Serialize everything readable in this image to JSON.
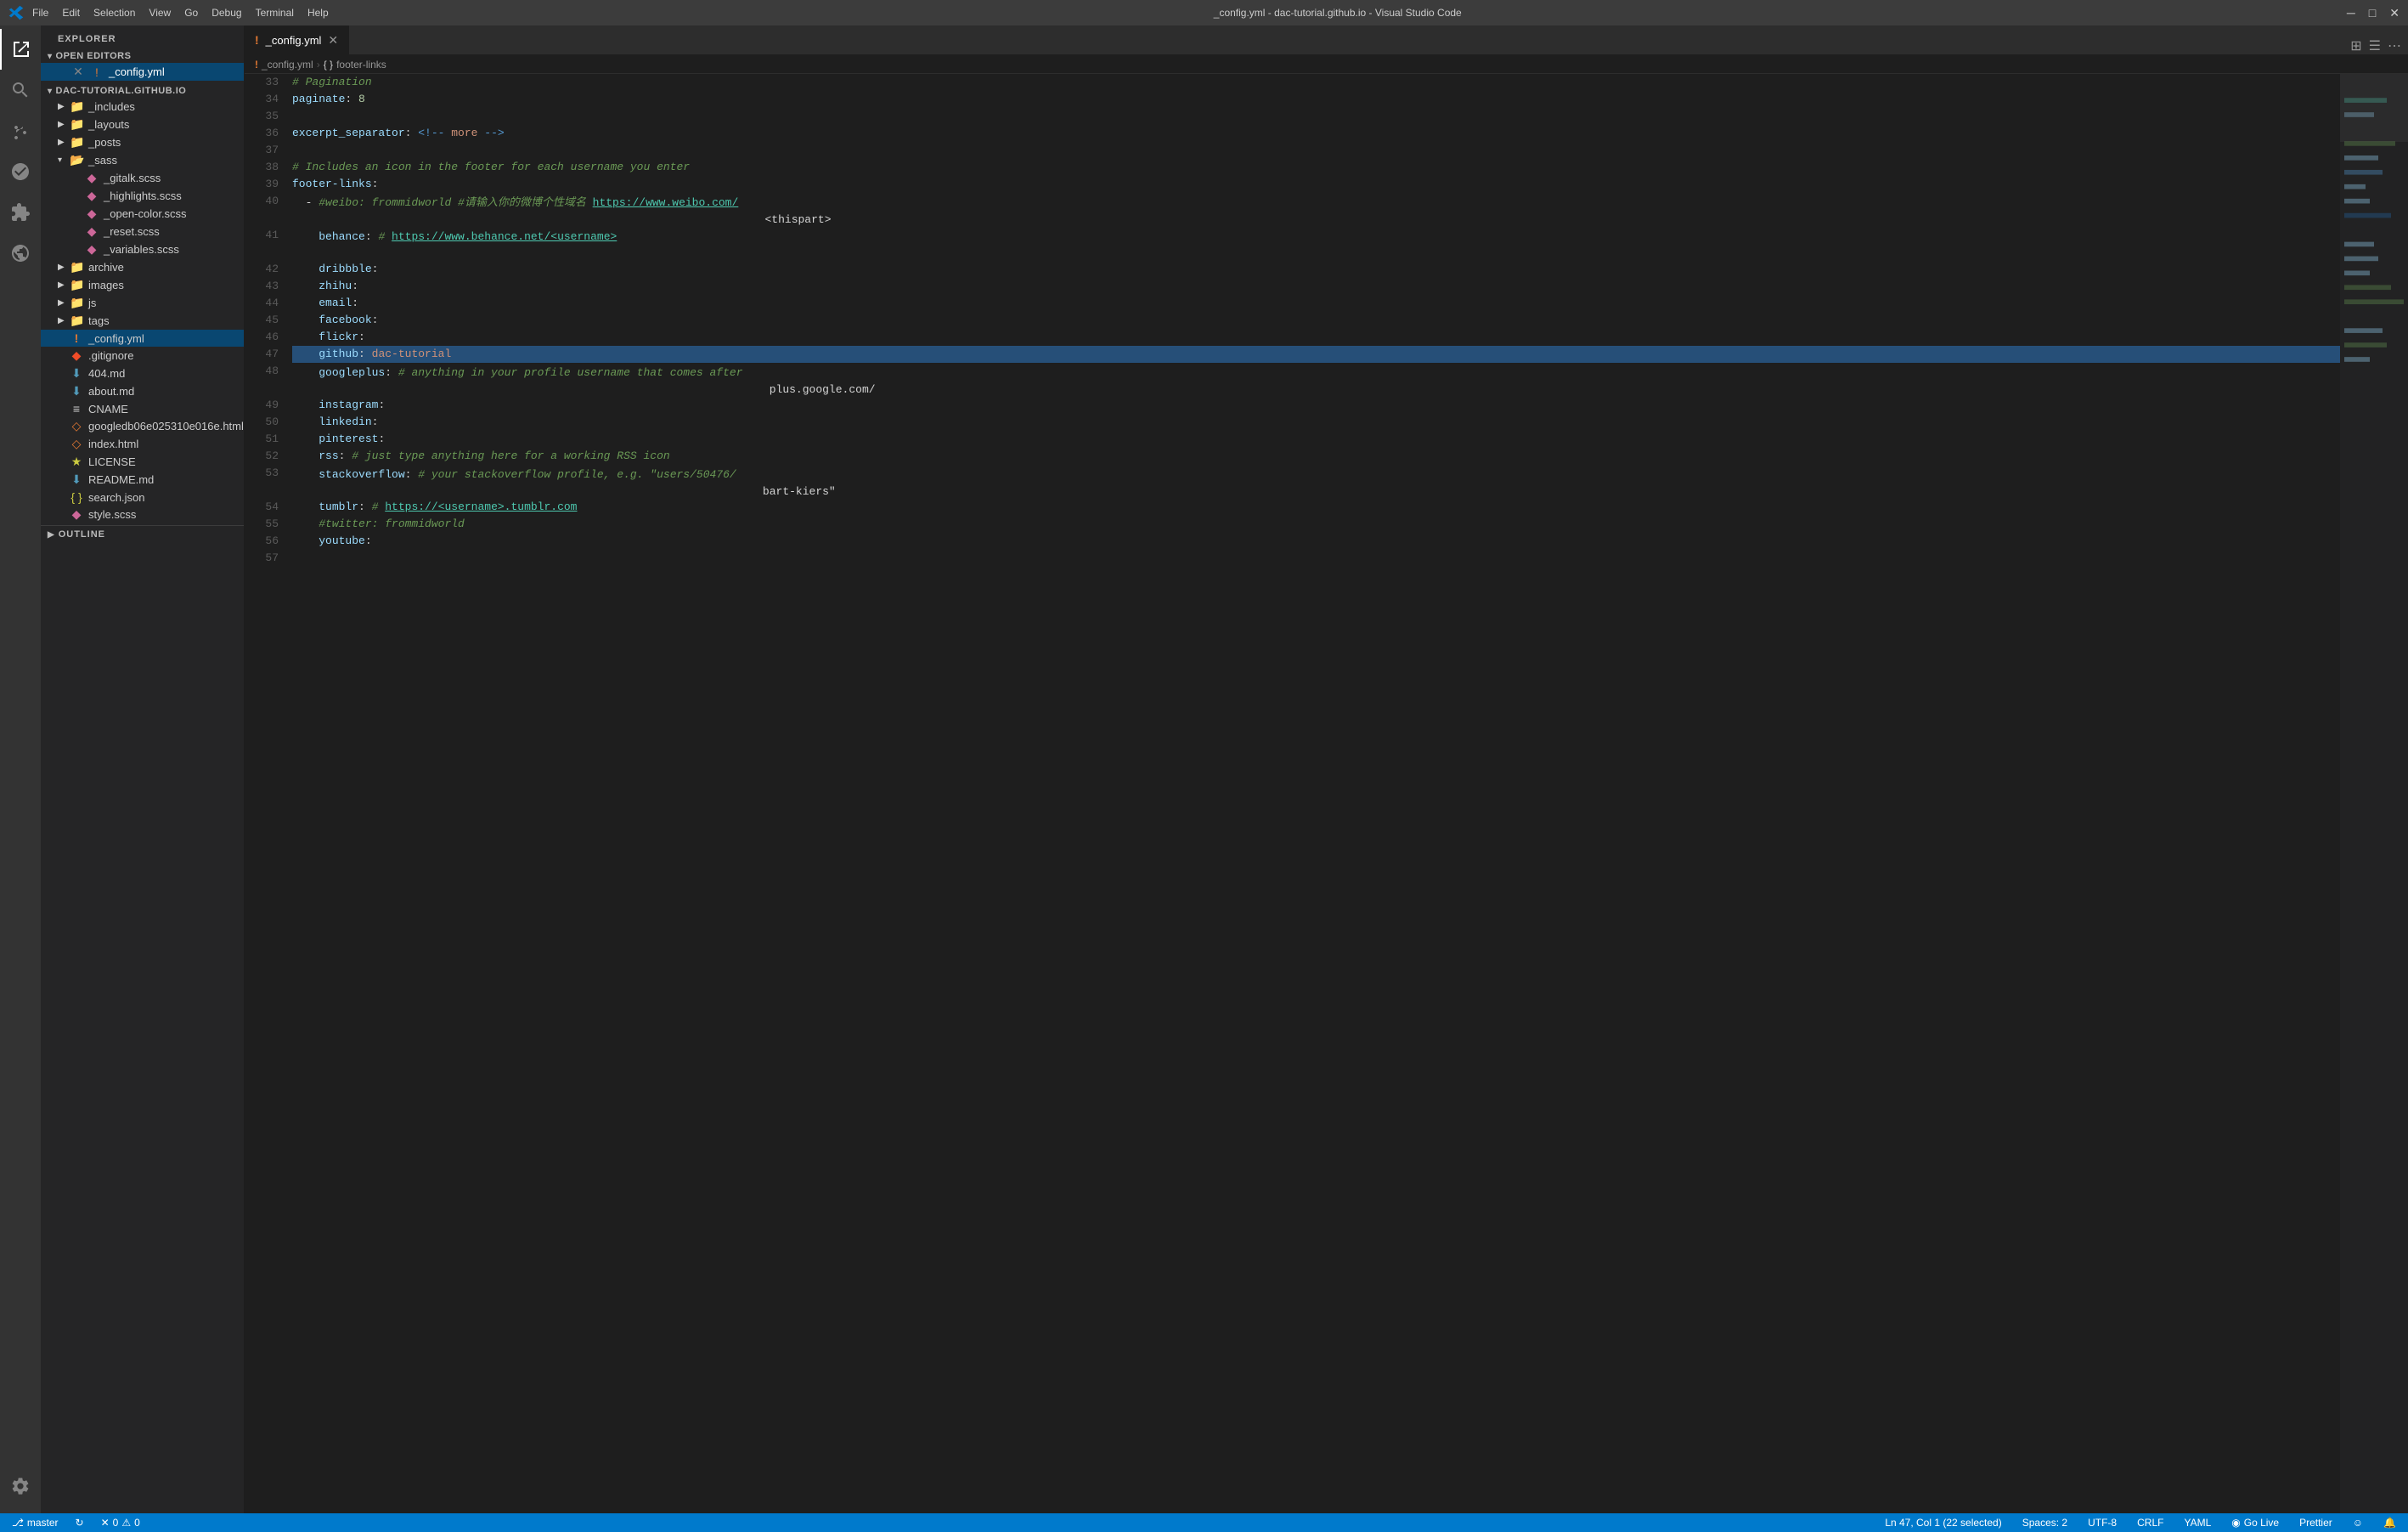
{
  "titlebar": {
    "title": "_config.yml - dac-tutorial.github.io - Visual Studio Code",
    "menu_items": [
      "File",
      "Edit",
      "Selection",
      "View",
      "Go",
      "Debug",
      "Terminal",
      "Help"
    ]
  },
  "activity_bar": {
    "items": [
      {
        "name": "explorer",
        "label": "Explorer",
        "active": true
      },
      {
        "name": "search",
        "label": "Search"
      },
      {
        "name": "source-control",
        "label": "Source Control"
      },
      {
        "name": "debug",
        "label": "Debug"
      },
      {
        "name": "extensions",
        "label": "Extensions"
      },
      {
        "name": "remote-explorer",
        "label": "Remote Explorer"
      }
    ],
    "bottom": {
      "name": "settings",
      "label": "Settings"
    }
  },
  "sidebar": {
    "header": "Explorer",
    "open_editors_label": "Open Editors",
    "open_editors": [
      {
        "name": "_config.yml",
        "icon": "!",
        "color": "yml",
        "active": true
      }
    ],
    "project_label": "DAC-TUTORIAL.GITHUB.IO",
    "tree": [
      {
        "name": "_includes",
        "type": "folder",
        "indent": 1,
        "collapsed": true
      },
      {
        "name": "_layouts",
        "type": "folder",
        "indent": 1,
        "collapsed": true
      },
      {
        "name": "_posts",
        "type": "folder",
        "indent": 1,
        "collapsed": true
      },
      {
        "name": "_sass",
        "type": "folder",
        "indent": 1,
        "collapsed": false
      },
      {
        "name": "_gitalk.scss",
        "type": "file",
        "ext": "scss",
        "indent": 2,
        "color": "sass"
      },
      {
        "name": "_highlights.scss",
        "type": "file",
        "ext": "scss",
        "indent": 2,
        "color": "sass"
      },
      {
        "name": "_open-color.scss",
        "type": "file",
        "ext": "scss",
        "indent": 2,
        "color": "sass"
      },
      {
        "name": "_reset.scss",
        "type": "file",
        "ext": "scss",
        "indent": 2,
        "color": "sass"
      },
      {
        "name": "_variables.scss",
        "type": "file",
        "ext": "scss",
        "indent": 2,
        "color": "sass"
      },
      {
        "name": "archive",
        "type": "folder",
        "indent": 1,
        "collapsed": true
      },
      {
        "name": "images",
        "type": "folder",
        "indent": 1,
        "collapsed": true
      },
      {
        "name": "js",
        "type": "folder",
        "indent": 1,
        "collapsed": true
      },
      {
        "name": "tags",
        "type": "folder",
        "indent": 1,
        "collapsed": true
      },
      {
        "name": "_config.yml",
        "type": "file",
        "ext": "yml",
        "indent": 1,
        "color": "yml",
        "selected": true
      },
      {
        "name": ".gitignore",
        "type": "file",
        "ext": "git",
        "indent": 1,
        "color": "git"
      },
      {
        "name": "404.md",
        "type": "file",
        "ext": "md",
        "indent": 1,
        "color": "md"
      },
      {
        "name": "about.md",
        "type": "file",
        "ext": "md",
        "indent": 1,
        "color": "md"
      },
      {
        "name": "CNAME",
        "type": "file",
        "ext": "cname",
        "indent": 1,
        "color": "cname"
      },
      {
        "name": "googledb06e025310e016e.html",
        "type": "file",
        "ext": "html",
        "indent": 1,
        "color": "html"
      },
      {
        "name": "index.html",
        "type": "file",
        "ext": "html",
        "indent": 1,
        "color": "html"
      },
      {
        "name": "LICENSE",
        "type": "file",
        "ext": "license",
        "indent": 1,
        "color": "license"
      },
      {
        "name": "README.md",
        "type": "file",
        "ext": "md",
        "indent": 1,
        "color": "md"
      },
      {
        "name": "search.json",
        "type": "file",
        "ext": "json",
        "indent": 1,
        "color": "json"
      },
      {
        "name": "style.scss",
        "type": "file",
        "ext": "scss",
        "indent": 1,
        "color": "sass"
      }
    ],
    "outline_label": "OUTLINE"
  },
  "editor": {
    "tab_name": "_config.yml",
    "breadcrumb": [
      "_config.yml",
      "footer-links"
    ],
    "lines": [
      {
        "num": 33,
        "content": "# Pagination",
        "type": "comment"
      },
      {
        "num": 34,
        "content": "paginate: 8",
        "type": "keyval"
      },
      {
        "num": 35,
        "content": "",
        "type": "empty"
      },
      {
        "num": 36,
        "content": "excerpt_separator: <!-- more -->",
        "type": "mixed"
      },
      {
        "num": 37,
        "content": "",
        "type": "empty"
      },
      {
        "num": 38,
        "content": "# Includes an icon in the footer for each username you enter",
        "type": "comment"
      },
      {
        "num": 39,
        "content": "footer-links:",
        "type": "key"
      },
      {
        "num": 40,
        "content": "  - #weibo: frommidworld #请输入你的微博个性域名 https://www.weibo.com/<thispart>",
        "type": "complex"
      },
      {
        "num": 41,
        "content": "    behance: # https://www.behance.net/<username>",
        "type": "complex"
      },
      {
        "num": 42,
        "content": "    dribbble:",
        "type": "key"
      },
      {
        "num": 43,
        "content": "    zhihu:",
        "type": "key"
      },
      {
        "num": 44,
        "content": "    email:",
        "type": "key"
      },
      {
        "num": 45,
        "content": "    facebook:",
        "type": "key"
      },
      {
        "num": 46,
        "content": "    flickr:",
        "type": "key"
      },
      {
        "num": 47,
        "content": "    github: dac-tutorial",
        "type": "keyval",
        "selected": true
      },
      {
        "num": 48,
        "content": "    googleplus: # anything in your profile username that comes after plus.google.com/",
        "type": "complex"
      },
      {
        "num": 49,
        "content": "    instagram:",
        "type": "key"
      },
      {
        "num": 50,
        "content": "    linkedin:",
        "type": "key"
      },
      {
        "num": 51,
        "content": "    pinterest:",
        "type": "key"
      },
      {
        "num": 52,
        "content": "    rss: # just type anything here for a working RSS icon",
        "type": "complex"
      },
      {
        "num": 53,
        "content": "    stackoverflow: # your stackoverflow profile, e.g. \"users/50476/bart-kiers\"",
        "type": "complex"
      },
      {
        "num": 54,
        "content": "    tumblr: # https://<username>.tumblr.com",
        "type": "complex"
      },
      {
        "num": 55,
        "content": "    #twitter: frommidworld",
        "type": "comment_line"
      },
      {
        "num": 56,
        "content": "    youtube:",
        "type": "key"
      },
      {
        "num": 57,
        "content": "",
        "type": "empty"
      }
    ]
  },
  "status_bar": {
    "branch": "master",
    "sync_icon": "↻",
    "errors": "0",
    "warnings": "0",
    "position": "Ln 47, Col 1 (22 selected)",
    "spaces": "Spaces: 2",
    "encoding": "UTF-8",
    "line_ending": "CRLF",
    "language": "YAML",
    "go_live": "Go Live",
    "prettier": "Prettier",
    "smiley": "☺",
    "bell": "🔔"
  }
}
